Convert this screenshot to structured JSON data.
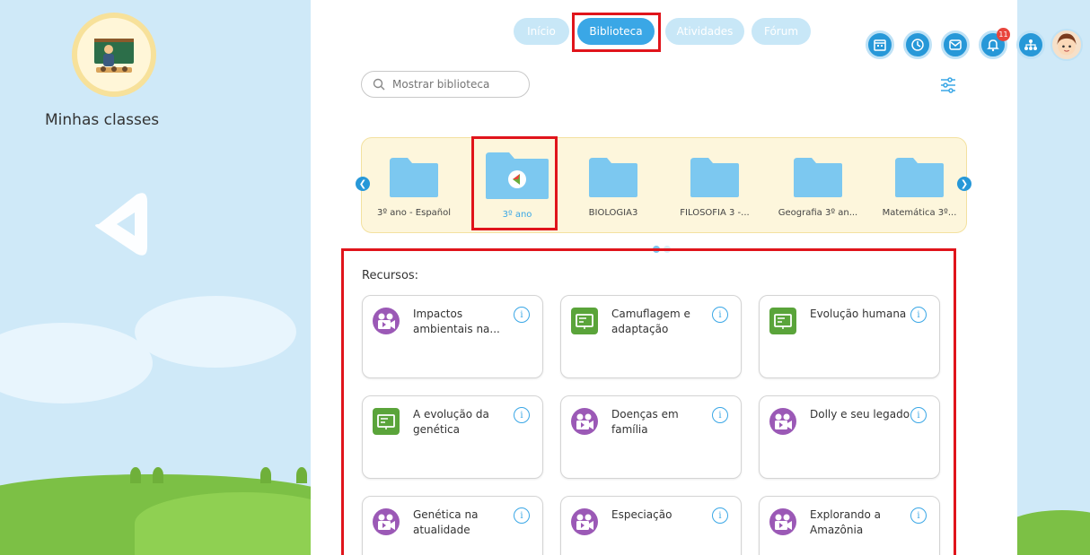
{
  "sidebar": {
    "title": "Minhas classes"
  },
  "tabs": [
    {
      "label": "Início",
      "active": false
    },
    {
      "label": "Biblioteca",
      "active": true
    },
    {
      "label": "Atividades",
      "active": false
    },
    {
      "label": "Fórum",
      "active": false
    }
  ],
  "header": {
    "icons": [
      "calendar-icon",
      "clock-icon",
      "mail-icon",
      "bell-icon",
      "org-chart-icon",
      "user-avatar"
    ],
    "notification_count": "11"
  },
  "search": {
    "placeholder": "Mostrar biblioteca"
  },
  "folders": [
    {
      "label": "3º ano - Español"
    },
    {
      "label": "3º ano",
      "active": true
    },
    {
      "label": "BIOLOGIA3"
    },
    {
      "label": "FILOSOFIA 3 -..."
    },
    {
      "label": "Geografia 3º an..."
    },
    {
      "label": "Matemática 3º..."
    }
  ],
  "carousel": {
    "pages": 2,
    "current_page": 1
  },
  "resources": {
    "label": "Recursos:",
    "items": [
      {
        "title": "Impactos ambientais na...",
        "type": "video"
      },
      {
        "title": "Camuflagem e adaptação",
        "type": "presentation"
      },
      {
        "title": "Evolução humana",
        "type": "presentation"
      },
      {
        "title": "A evolução da genética",
        "type": "presentation"
      },
      {
        "title": "Doenças em família",
        "type": "video"
      },
      {
        "title": "Dolly e seu legado",
        "type": "video"
      },
      {
        "title": "Genética na atualidade",
        "type": "video"
      },
      {
        "title": "Especiação",
        "type": "video"
      },
      {
        "title": "Explorando a Amazônia",
        "type": "video"
      }
    ]
  },
  "colors": {
    "accent": "#3aa7e6",
    "highlight": "#e0141b",
    "video": "#9b59b6",
    "presentation": "#5aa43a"
  }
}
